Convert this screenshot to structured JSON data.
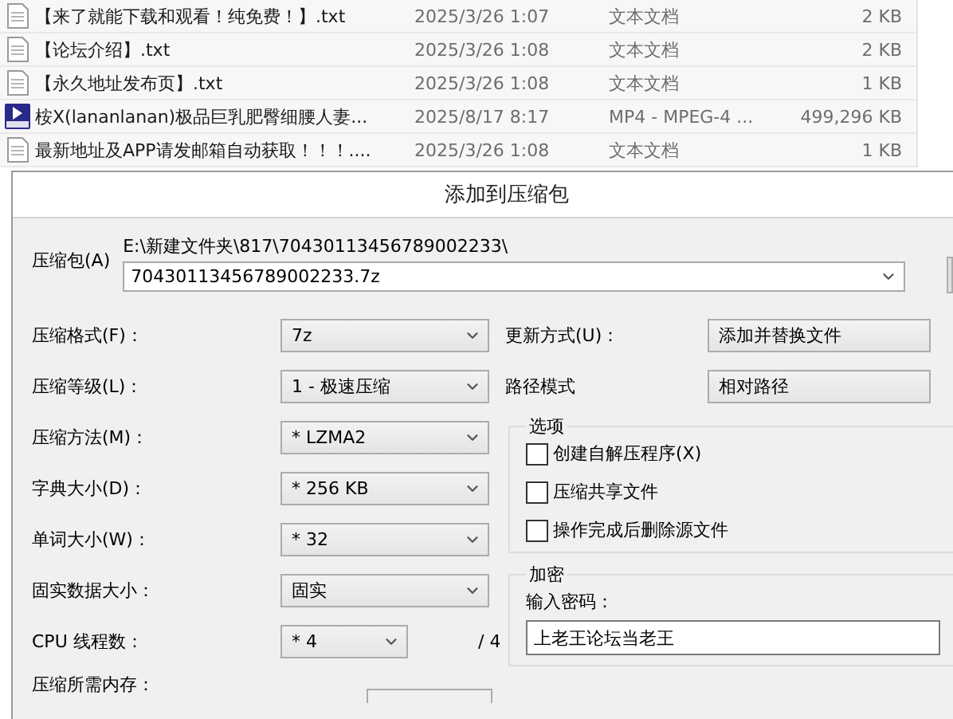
{
  "file_list": {
    "rows": [
      {
        "kind": "text",
        "name": "【来了就能下载和观看！纯免费！】.txt",
        "date": "2025/3/26 1:07",
        "type": "文本文档",
        "size": "2 KB"
      },
      {
        "kind": "text",
        "name": "【论坛介绍】.txt",
        "date": "2025/3/26 1:08",
        "type": "文本文档",
        "size": "2 KB"
      },
      {
        "kind": "text",
        "name": "【永久地址发布页】.txt",
        "date": "2025/3/26 1:08",
        "type": "文本文档",
        "size": "1 KB"
      },
      {
        "kind": "video",
        "name": "桉X(lananlanan)极品巨乳肥臀细腰人妻...",
        "date": "2025/8/17 8:17",
        "type": "MP4 - MPEG-4 ...",
        "size": "499,296 KB"
      },
      {
        "kind": "text",
        "name": "最新地址及APP请发邮箱自动获取！！！....",
        "date": "2025/3/26 1:08",
        "type": "文本文档",
        "size": "1 KB"
      }
    ]
  },
  "dialog": {
    "title": "添加到压缩包",
    "archive": {
      "label": "压缩包(A)",
      "path": "E:\\新建文件夹\\817\\70430113456789002233\\",
      "value": "70430113456789002233.7z"
    },
    "left_fields": [
      {
        "kind": "select",
        "label": "压缩格式(F)：",
        "value": "7z"
      },
      {
        "kind": "select",
        "label": "压缩等级(L)：",
        "value": "1 - 极速压缩"
      },
      {
        "kind": "select",
        "label": "压缩方法(M)：",
        "value": "* LZMA2"
      },
      {
        "kind": "select",
        "label": "字典大小(D)：",
        "value": "* 256 KB"
      },
      {
        "kind": "select",
        "label": "单词大小(W)：",
        "value": "* 32"
      },
      {
        "kind": "select",
        "label": "固实数据大小：",
        "value": "固实"
      },
      {
        "kind": "short_select",
        "label": "CPU 线程数：",
        "value": "* 4",
        "suffix": "/ 4"
      },
      {
        "kind": "readout",
        "label": "压缩所需内存："
      }
    ],
    "right_fields": [
      {
        "label": "更新方式(U)：",
        "value": "添加并替换文件"
      },
      {
        "label": "路径模式",
        "value": "相对路径"
      }
    ],
    "options": {
      "title": "选项",
      "items": [
        {
          "label": "创建自解压程序(X)",
          "checked": false
        },
        {
          "label": "压缩共享文件",
          "checked": false
        },
        {
          "label": "操作完成后删除源文件",
          "checked": false
        }
      ]
    },
    "encryption": {
      "title": "加密",
      "password_label": "输入密码：",
      "password_value": "上老王论坛当老王"
    }
  }
}
